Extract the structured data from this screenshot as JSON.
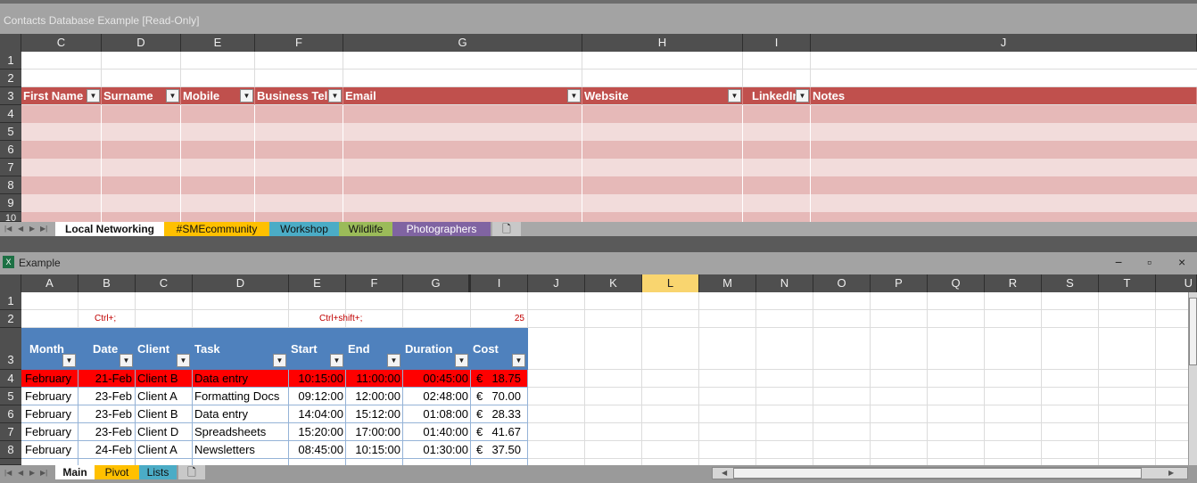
{
  "top_window": {
    "title": "Contacts Database Example  [Read-Only]",
    "columns": [
      "C",
      "D",
      "E",
      "F",
      "G",
      "H",
      "I",
      "J"
    ],
    "rows": [
      "1",
      "2",
      "3",
      "4",
      "5",
      "6",
      "7",
      "8",
      "9",
      "10"
    ],
    "headers": [
      "First Name",
      "Surname",
      "Mobile",
      "Business Tel",
      "Email",
      "Website",
      "LinkedIn",
      "Notes"
    ],
    "tabs": [
      "Local Networking",
      "#SMEcommunity",
      "Workshop",
      "Wildlife",
      "Photographers"
    ],
    "tab_colors": [
      "#ffffff",
      "#ffc000",
      "#4bacc6",
      "#9bbb59",
      "#8064a2"
    ]
  },
  "bottom_window": {
    "title": "Example",
    "controls": [
      "−",
      "▫",
      "×"
    ],
    "columns": [
      "A",
      "B",
      "C",
      "D",
      "E",
      "F",
      "G",
      "I",
      "J",
      "K",
      "L",
      "M",
      "N",
      "O",
      "P",
      "Q",
      "R",
      "S",
      "T",
      "U"
    ],
    "rows": [
      "1",
      "2",
      "3",
      "4",
      "5",
      "6",
      "7",
      "8"
    ],
    "row2": {
      "b": "Ctrl+;",
      "e": "Ctrl+shift+;",
      "i": "25"
    },
    "headers": [
      "Month",
      "Date",
      "Client",
      "Task",
      "Start",
      "End",
      "Duration",
      "Cost"
    ],
    "data": [
      [
        "February",
        "21-Feb",
        "Client B",
        "Data entry",
        "10:15:00",
        "11:00:00",
        "00:45:00",
        "€",
        "18.75"
      ],
      [
        "February",
        "23-Feb",
        "Client A",
        "Formatting Docs",
        "09:12:00",
        "12:00:00",
        "02:48:00",
        "€",
        "70.00"
      ],
      [
        "February",
        "23-Feb",
        "Client B",
        "Data entry",
        "14:04:00",
        "15:12:00",
        "01:08:00",
        "€",
        "28.33"
      ],
      [
        "February",
        "23-Feb",
        "Client D",
        "Spreadsheets",
        "15:20:00",
        "17:00:00",
        "01:40:00",
        "€",
        "41.67"
      ],
      [
        "February",
        "24-Feb",
        "Client A",
        "Newsletters",
        "08:45:00",
        "10:15:00",
        "01:30:00",
        "€",
        "37.50"
      ]
    ],
    "tabs": [
      "Main",
      "Pivot",
      "Lists"
    ],
    "tab_colors": [
      "#ffffff",
      "#ffc000",
      "#4bacc6"
    ],
    "selected_column": "L",
    "highlight_color": "#ff0000"
  }
}
